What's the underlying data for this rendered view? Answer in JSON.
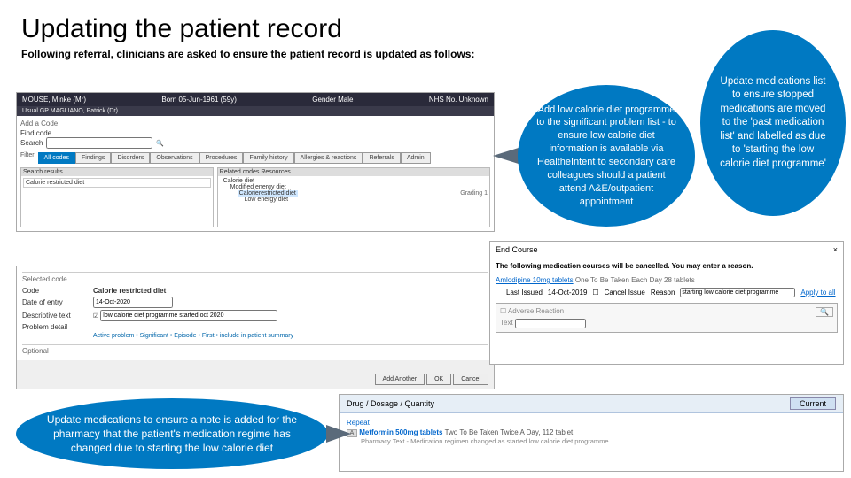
{
  "title": "Updating the patient record",
  "subtitle": "Following referral, clinicians are asked to ensure the patient record is updated as follows:",
  "callouts": {
    "problem_list": "Add low calorie diet programme to the significant problem list - to ensure low calorie diet information is available via HealtheIntent to secondary care colleagues should a patient attend A&E/outpatient appointment",
    "med_update": "Update medications list to ensure stopped medications are moved to the 'past medication list' and labelled as due to 'starting the low calorie diet programme'",
    "pharmacy_note": "Update medications to ensure a note is added for the pharmacy that the patient's medication regime has changed due to starting the low calorie diet"
  },
  "ehr1": {
    "patient": "MOUSE, Minke (Mr)",
    "dob": "Born 05-Jun-1961 (59y)",
    "gender": "Gender Male",
    "nhs": "NHS No. Unknown",
    "gp": "Usual GP  MAGLIANO, Patrick (Dr)",
    "section": "Add a Code",
    "search_label": "Search",
    "find_code": "Find code",
    "tabs": [
      "All codes",
      "Findings",
      "Disorders",
      "Observations",
      "Procedures",
      "Family history",
      "Allergies & reactions",
      "Referrals",
      "Admin"
    ],
    "filter_label": "Filter",
    "left_head": "Search results",
    "left_item": "Calorie restricted diet",
    "right_head": "Related codes   Resources",
    "right_items": [
      "Calorie diet",
      "Modified energy diet",
      "Calorierestricted diet",
      "Low energy diet"
    ],
    "grading": "Grading 1"
  },
  "ehr2": {
    "selected_label": "Selected code",
    "rows": {
      "code_label": "Code",
      "code_value": "Calorie restricted diet",
      "date_label": "Date of entry",
      "date_value": "14-Oct-2020",
      "desc_label": "Descriptive text",
      "desc_value": "low calorie diet programme started oct 2020",
      "problem_label": "Problem detail"
    },
    "flags": "Active problem • Significant • Episode • First   • include in patient summary",
    "optional_label": "Optional",
    "buttons": [
      "Add Another",
      "OK",
      "Cancel"
    ]
  },
  "ehr3": {
    "title": "End Course",
    "close": "×",
    "banner": "The following medication courses will be cancelled. You may enter a reason.",
    "med": "Amlodipine 10mg tablets",
    "med_dir": "One To Be Taken Each Day  28 tablets",
    "issued_label": "Last Issued",
    "issued_value": "14-Oct-2019",
    "cancel_label": "Cancel Issue",
    "reason_label": "Reason",
    "reason_value": "starting low calorie diet programme",
    "apply": "Apply to all",
    "adverse": "Adverse Reaction",
    "text_label": "Text"
  },
  "ehr4": {
    "header": "Drug / Dosage / Quantity",
    "current": "Current",
    "repeat": "Repeat",
    "marker": "A",
    "med": "Metformin 500mg tablets",
    "direction": "Two To Be Taken Twice A Day, 112 tablet",
    "pharmacy": "Pharmacy Text - Medication regimen changed as started low calorie diet programme"
  }
}
